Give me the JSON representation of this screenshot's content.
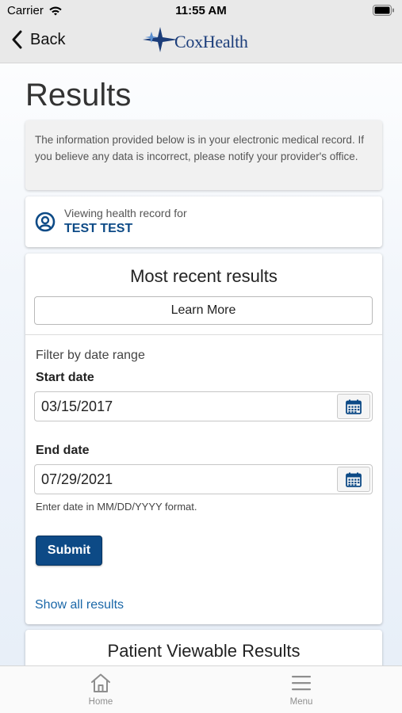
{
  "status_bar": {
    "carrier": "Carrier",
    "time": "11:55 AM"
  },
  "nav": {
    "back_label": "Back",
    "logo_text": "CoxHealth"
  },
  "page": {
    "title": "Results",
    "notice": "The information provided below is in your electronic medical record. If you believe any data is incorrect, please notify your provider's office."
  },
  "viewing": {
    "label": "Viewing health record for",
    "name": "TEST TEST"
  },
  "results": {
    "heading": "Most recent results",
    "learn_more_label": "Learn More",
    "filter_label": "Filter by date range",
    "start_date_label": "Start date",
    "start_date_value": "03/15/2017",
    "end_date_label": "End date",
    "end_date_value": "07/29/2021",
    "date_hint": "Enter date in MM/DD/YYYY format.",
    "submit_label": "Submit",
    "show_all_label": "Show all results"
  },
  "viewable": {
    "heading": "Patient Viewable Results"
  },
  "tab_bar": {
    "home_label": "Home",
    "menu_label": "Menu"
  },
  "colors": {
    "accent": "#0d4a86",
    "link": "#1a67a8",
    "bar_bg": "#e9e9e9"
  },
  "icons": [
    "wifi-icon",
    "battery-icon",
    "chevron-left-icon",
    "coxhealth-star-logo",
    "account-circle-icon",
    "calendar-icon",
    "home-icon",
    "menu-icon"
  ]
}
